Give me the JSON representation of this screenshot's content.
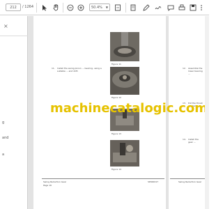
{
  "toolbar": {
    "current_page": "212",
    "total_pages": "/ 1264",
    "zoom": "50.4%"
  },
  "icons": [
    "pointer-icon",
    "hand-icon",
    "zoom-out-icon",
    "zoom-in-icon",
    "fit-page-icon",
    "page-view-icon",
    "annotate-icon",
    "sign-icon",
    "comment-icon",
    "print-icon",
    "save-icon",
    "more-icon"
  ],
  "sidebar": {
    "close": "×",
    "fragments": [
      "g",
      "and",
      "a"
    ]
  },
  "page": {
    "figures": [
      "Figure 11",
      "Figure 12",
      "Figure 13",
      "Figure 14"
    ],
    "steps": [
      {
        "num": "11.",
        "text": "Install the swing pinion ... bearing, using a suitable ... and drift."
      },
      {
        "num": "12.",
        "text": "Assemble the lower bearing ..."
      },
      {
        "num": "13.",
        "text": "Put the thrust washer ..."
      },
      {
        "num": "14.",
        "text": "Install the gear ..."
      }
    ],
    "watermark": "machinecatalogic.com",
    "footer_left": "Swing Reduction Gear",
    "footer_left_page": "Page 16",
    "footer_mid": "SP000017",
    "footer_right": "Swing Reduction Gear"
  }
}
